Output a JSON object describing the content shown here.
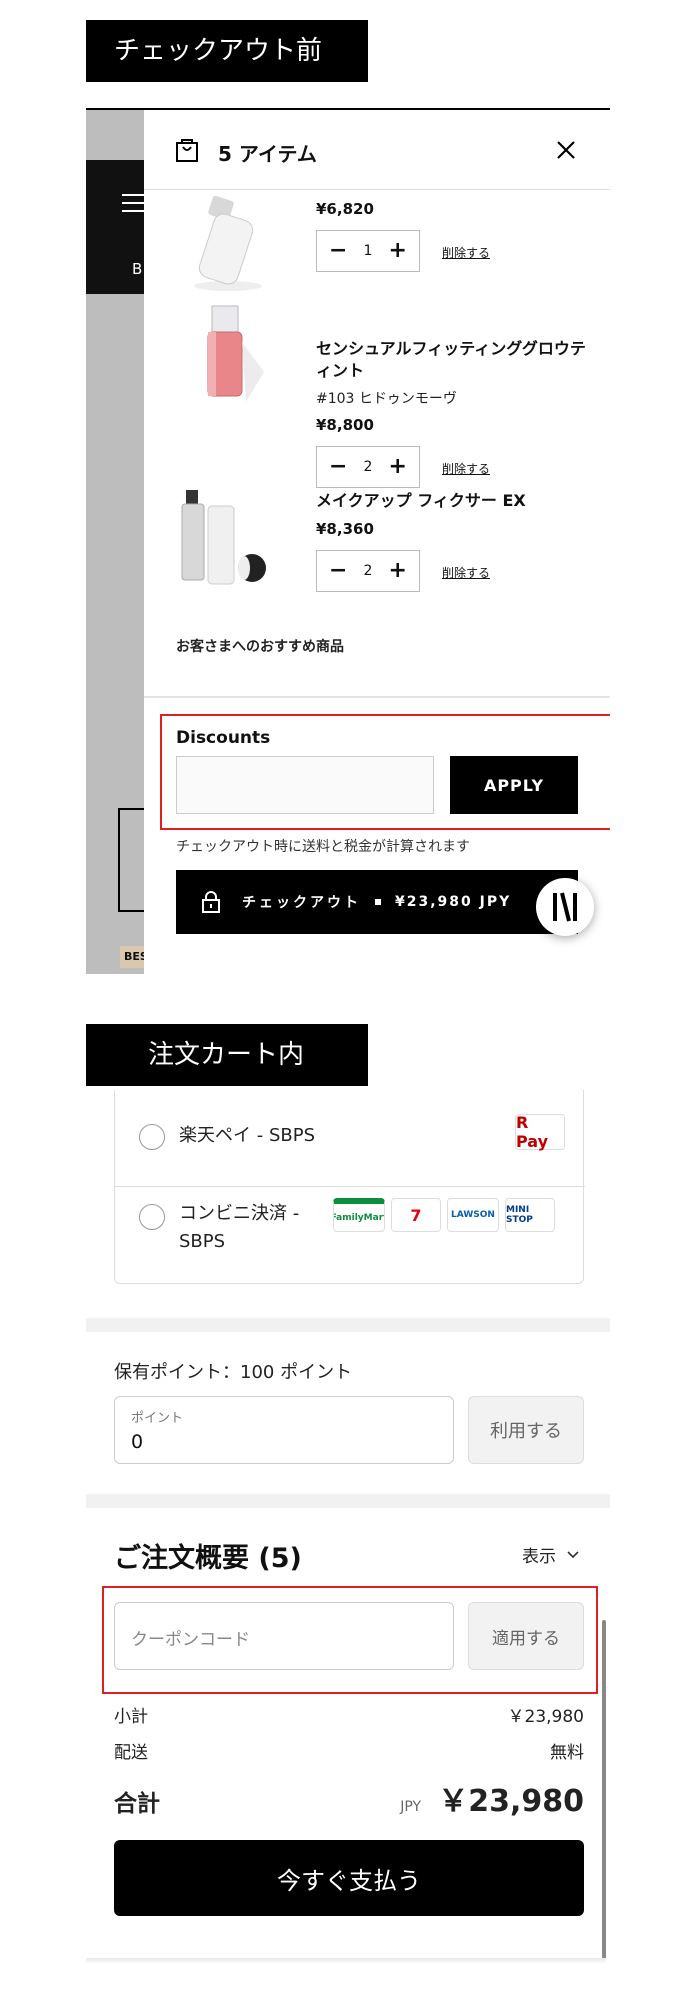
{
  "labels": {
    "before": "チェックアウト前",
    "in_cart": "注文カート内"
  },
  "drawer": {
    "title": "5 アイテム",
    "background_letter": "B",
    "background_badge": "BES",
    "items": [
      {
        "name": "",
        "variant": "",
        "price": "¥6,820",
        "qty": "1",
        "remove": "削除する"
      },
      {
        "name": "センシュアルフィッティンググロウティント",
        "variant": "#103 ヒドゥンモーヴ",
        "price": "¥8,800",
        "qty": "2",
        "remove": "削除する"
      },
      {
        "name": "メイクアップ フィクサー EX",
        "variant": "",
        "price": "¥8,360",
        "qty": "2",
        "remove": "削除する"
      }
    ],
    "qty_minus": "−",
    "qty_plus": "+",
    "recommend": "お客さまへのおすすめ商品",
    "discounts_title": "Discounts",
    "apply": "APPLY",
    "tax_note": "チェックアウト時に送料と税金が計算されます",
    "checkout_label": "チェックアウト",
    "checkout_amount": "¥23,980 JPY",
    "badge_text": "N"
  },
  "payment": {
    "options": [
      {
        "name": "楽天ペイ - SBPS",
        "logo": "R Pay"
      },
      {
        "name": "コンビニ決済 - SBPS"
      }
    ],
    "store_logos": [
      "FamilyMart",
      "7",
      "LAWSON",
      "MINI STOP"
    ]
  },
  "points": {
    "held": "保有ポイント：100 ポイント",
    "field_label": "ポイント",
    "field_value": "0",
    "use_button": "利用する"
  },
  "summary": {
    "title": "ご注文概要 (5)",
    "toggle": "表示",
    "coupon_placeholder": "クーポンコード",
    "apply_button": "適用する",
    "subtotal_label": "小計",
    "subtotal_value": "￥23,980",
    "shipping_label": "配送",
    "shipping_value": "無料",
    "total_label": "合計",
    "currency": "JPY",
    "total_value": "￥23,980",
    "pay_button": "今すぐ支払う"
  },
  "colors": {
    "highlight": "#e02020",
    "rpay": "#bf0000",
    "familymart": "#0b8f3c",
    "seven": "#e60012",
    "lawson": "#0a5ea8",
    "ministop": "#003d8f"
  }
}
